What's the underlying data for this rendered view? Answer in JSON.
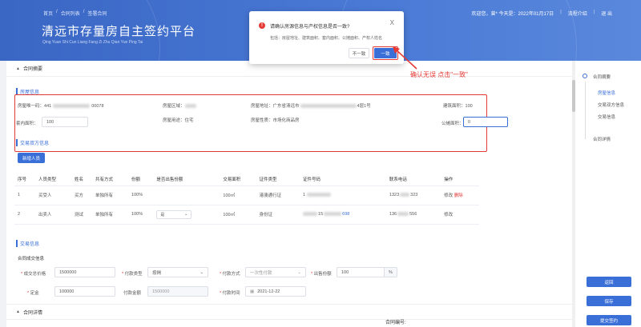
{
  "header": {
    "breadcrumb": [
      "首页",
      "/",
      "合同列表",
      "/",
      "签署合同"
    ],
    "title": "清远市存量房自主签约平台",
    "subtitle": "Qing Yuan Shi Cun Liang Fang Zi Zhu Qian Yue Ping Tai",
    "welcome": "欢迎您，曾* 今天是：2022年01月17日",
    "guide": "流程介绍",
    "logout": "退 出"
  },
  "sections": {
    "contract_summary": "合同摘要",
    "contract_terms": "合同详情"
  },
  "house": {
    "title": "房屋信息",
    "unique_code_label": "房屋唯一码：",
    "unique_code_prefix": "441",
    "unique_code_suffix": "00078",
    "district_label": "房屋区域：",
    "address_label": "房屋地址：",
    "address_value": "广东省清远市",
    "address_tail": "4层1号",
    "building_area_label": "建筑面积：",
    "building_area_value": "100",
    "inner_area_label": "套内面积：",
    "inner_area_value": "100",
    "usage_label": "房屋用途：",
    "usage_value": "住宅",
    "nature_label": "房屋性质：",
    "nature_value": "市场化商品房",
    "shared_area_label": "公摊面积：",
    "shared_area_value": "0"
  },
  "parties": {
    "title": "交易双方信息",
    "add_button": "新增人员",
    "columns": [
      "序号",
      "人员类型",
      "姓名",
      "共有方式",
      "份额",
      "是否出售份额",
      "交易面积",
      "证件类型",
      "证件号码",
      "联系电话",
      "操作"
    ],
    "rows": [
      {
        "no": "1",
        "type": "买受人",
        "name": "买方",
        "share_mode": "单独所有",
        "share": "100%",
        "sell_share": "",
        "area": "100㎡",
        "id_type": "港澳通行证",
        "id_no": "1",
        "phone_a": "1323",
        "phone_b": "323",
        "edit": "修改",
        "delete": "删除"
      },
      {
        "no": "2",
        "type": "出卖人",
        "name": "测试",
        "share_mode": "单独所有",
        "share": "100%",
        "sell_share": "是",
        "area": "100㎡",
        "id_type": "身份证",
        "id_no": "15",
        "id_tail": "698",
        "phone_a": "136",
        "phone_b": "556",
        "edit": "修改",
        "delete": ""
      }
    ]
  },
  "deal": {
    "title": "交易信息",
    "subtitle": "合同成交信息",
    "total_price_label": "成交总价格",
    "total_price_value": "1500000",
    "payment_type_label": "付款类型",
    "payment_type_value": "按揭",
    "pay_method_label": "付款方式",
    "pay_method_placeholder": "一次性付款",
    "sell_share_label": "出售份额",
    "sell_share_value": "100",
    "sell_share_suffix": "%",
    "deposit_label": "定金",
    "deposit_value": "100000",
    "down_payment_label": "付款金额",
    "down_payment_value": "1500000",
    "pay_date_label": "付款时间",
    "pay_date_value": "2021-12-22"
  },
  "sidebar": {
    "items": [
      "合同摘要",
      "房屋信息",
      "交易双方信息",
      "交易信息",
      "合同详情"
    ],
    "back": "返回",
    "save": "保存",
    "submit": "提交签约"
  },
  "modal": {
    "title": "请确认房源信息与产权信息是否一致?",
    "body": "包括：房屋地址、建筑面积、套内面积、公摊面积、产权人姓名",
    "no": "不一致",
    "yes": "一致",
    "close": "X"
  },
  "annotation": "确认无误 点击\"一致\"",
  "bottom_text": "合同编号:",
  "colors": {
    "primary": "#3a6fd8",
    "annotation": "#e53935"
  }
}
